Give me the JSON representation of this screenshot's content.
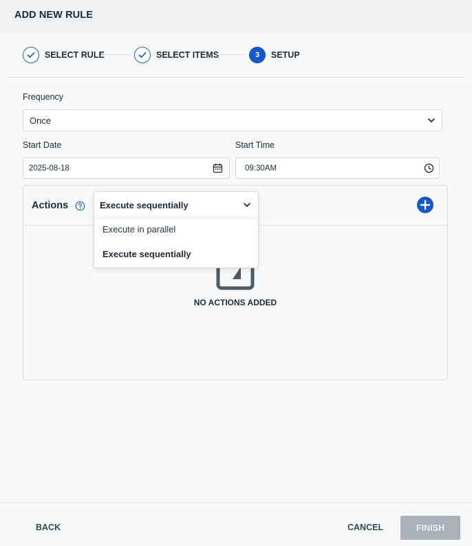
{
  "header": {
    "title": "ADD NEW RULE"
  },
  "stepper": {
    "steps": [
      {
        "label": "SELECT RULE",
        "status": "done"
      },
      {
        "label": "SELECT ITEMS",
        "status": "done"
      },
      {
        "label": "SETUP",
        "status": "active",
        "number": "3"
      }
    ]
  },
  "form": {
    "frequency": {
      "label": "Frequency",
      "value": "Once"
    },
    "start_date": {
      "label": "Start Date",
      "value": "2025-08-18"
    },
    "start_time": {
      "label": "Start Time",
      "value": "09:30AM"
    }
  },
  "actions": {
    "title": "Actions",
    "mode": {
      "selected": "Execute sequentially",
      "options": [
        "Execute in parallel",
        "Execute sequentially"
      ]
    },
    "empty_text": "NO ACTIONS ADDED"
  },
  "footer": {
    "back_label": "BACK",
    "cancel_label": "CANCEL",
    "finish_label": "FINISH"
  },
  "colors": {
    "accent": "#1456cc",
    "finish_disabled": "#a9b1ba",
    "background": "#f7f9fb"
  },
  "icons": [
    "check-icon",
    "chevron-down-icon",
    "calendar-icon",
    "clock-icon",
    "help-icon",
    "plus-icon",
    "empty-actions-icon"
  ]
}
